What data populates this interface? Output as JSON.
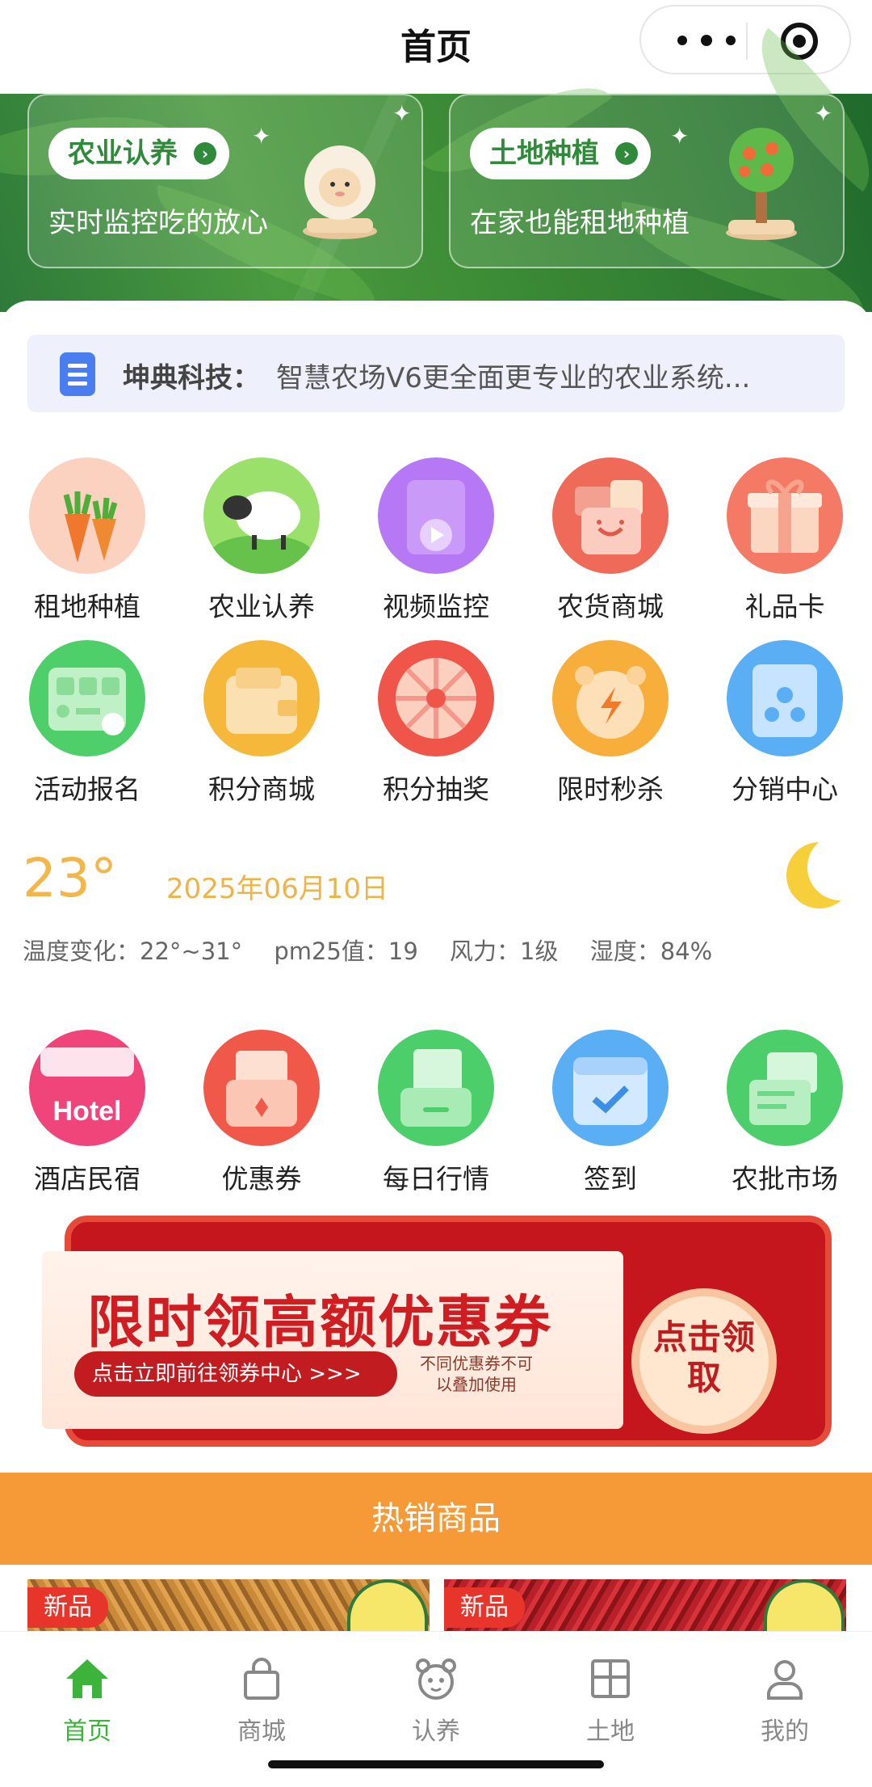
{
  "nav": {
    "title": "首页"
  },
  "banner": {
    "cards": [
      {
        "tag": "农业认养",
        "subtitle": "实时监控吃的放心"
      },
      {
        "tag": "土地种植",
        "subtitle": "在家也能租地种植"
      }
    ]
  },
  "notice": {
    "label": "坤典科技：",
    "text": "智慧农场V6更全面更专业的农业系统..."
  },
  "grid_row1": [
    {
      "label": "租地种植",
      "icon": "carrot-icon"
    },
    {
      "label": "农业认养",
      "icon": "sheep-icon"
    },
    {
      "label": "视频监控",
      "icon": "video-play-icon"
    },
    {
      "label": "农货商城",
      "icon": "shopping-bag-icon"
    },
    {
      "label": "礼品卡",
      "icon": "gift-box-icon"
    }
  ],
  "grid_row2": [
    {
      "label": "活动报名",
      "icon": "registration-card-icon"
    },
    {
      "label": "积分商城",
      "icon": "wallet-icon"
    },
    {
      "label": "积分抽奖",
      "icon": "prize-wheel-icon"
    },
    {
      "label": "限时秒杀",
      "icon": "alarm-clock-icon"
    },
    {
      "label": "分销中心",
      "icon": "distribution-icon"
    }
  ],
  "weather": {
    "temp": "23°",
    "date": "2025年06月10日",
    "range": "温度变化：22°~31°",
    "pm": "pm25值：19",
    "wind": "风力：1级",
    "humidity": "湿度：84%"
  },
  "grid_row3": [
    {
      "label": "酒店民宿",
      "icon": "hotel-icon",
      "icon_text": "Hotel"
    },
    {
      "label": "优惠券",
      "icon": "coupon-icon"
    },
    {
      "label": "每日行情",
      "icon": "news-tray-icon"
    },
    {
      "label": "签到",
      "icon": "calendar-check-icon"
    },
    {
      "label": "农批市场",
      "icon": "receipt-icon"
    }
  ],
  "coupon": {
    "title": "限时领高额优惠券",
    "link": "点击立即前往领券中心 >>>",
    "note": "不同优惠券不可以叠加使用",
    "button": "点击领取"
  },
  "hot": {
    "title": "热销商品",
    "products": [
      {
        "badge": "新品"
      },
      {
        "badge": "新品"
      }
    ]
  },
  "tabs": [
    {
      "label": "首页",
      "icon": "home-icon",
      "active": true
    },
    {
      "label": "商城",
      "icon": "bag-icon",
      "active": false
    },
    {
      "label": "认养",
      "icon": "bear-icon",
      "active": false
    },
    {
      "label": "土地",
      "icon": "grid-land-icon",
      "active": false
    },
    {
      "label": "我的",
      "icon": "user-icon",
      "active": false
    }
  ],
  "colors": {
    "primary": "#3cb43c",
    "orange": "#f59a36",
    "red": "#d01d22",
    "weather": "#f3b64a"
  }
}
